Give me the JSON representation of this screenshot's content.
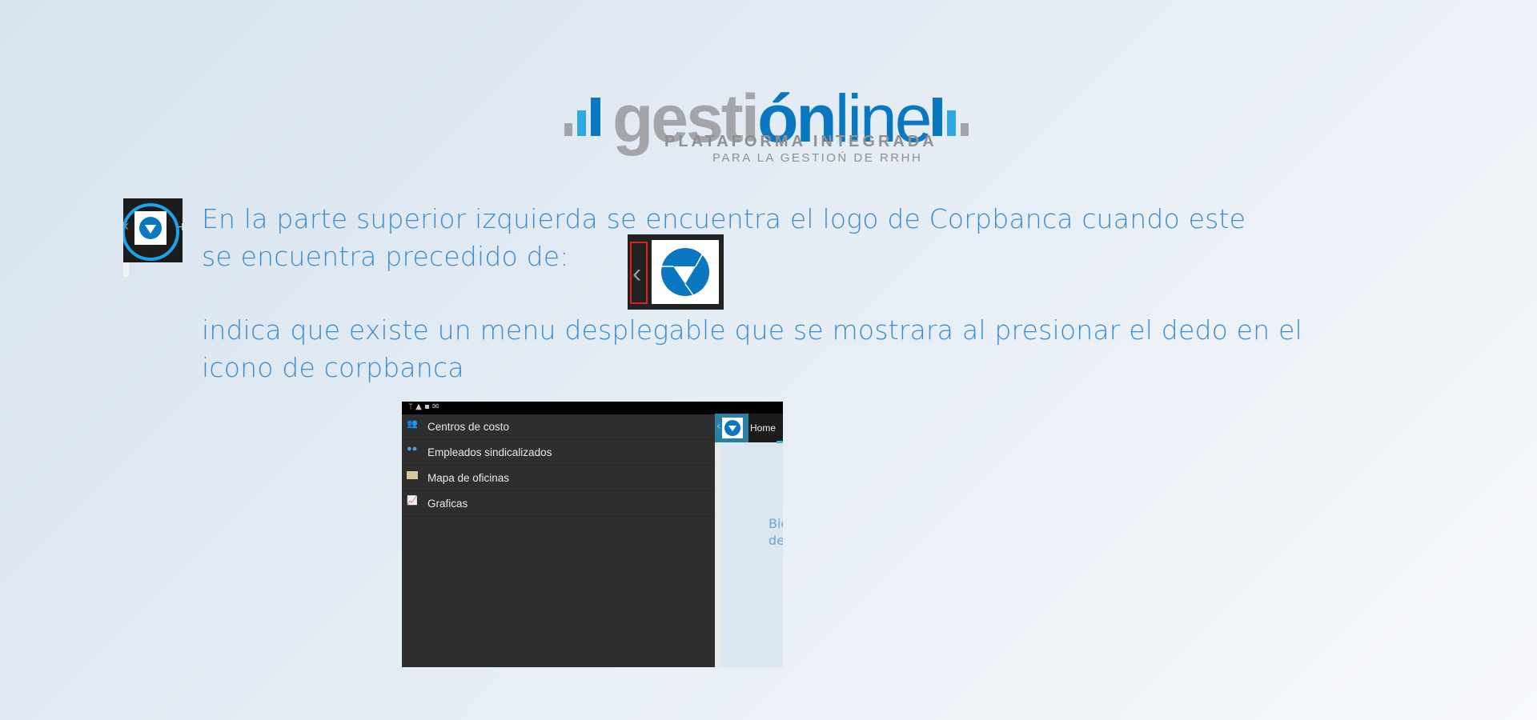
{
  "logo": {
    "word_gray": "gesti",
    "word_blue": "ón",
    "word_light": "line",
    "tagline": "PLATAFORMA INTEGRADA",
    "subtagline": "PARA LA GESTIOŃ DE RRHH"
  },
  "paragraph1": "En la parte superior izquierda se encuentra el logo de Corpbanca cuando este se encuentra precedido de:",
  "paragraph2": "indica que existe un menu desplegable que se mostrara al presionar el dedo en el icono de corpbanca",
  "phone": {
    "menu": [
      {
        "label": "Centros de costo",
        "icon": "people-icon"
      },
      {
        "label": "Empleados sindicalizados",
        "icon": "users-icon"
      },
      {
        "label": "Mapa de oficinas",
        "icon": "map-icon"
      },
      {
        "label": "Graficas",
        "icon": "chart-icon"
      }
    ],
    "header_title": "Home",
    "welcome_line1": "Bie",
    "welcome_line2": "de"
  },
  "colors": {
    "text": "#3a8dcc",
    "brand_blue": "#0b77c0",
    "highlight_red": "#e02020",
    "circle": "#1aa3e8"
  }
}
